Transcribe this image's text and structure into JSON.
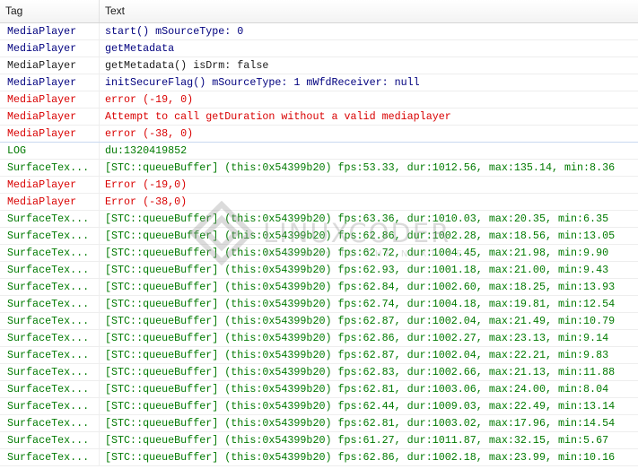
{
  "columns": {
    "tag": "Tag",
    "text": "Text"
  },
  "colors": {
    "debug": "#00007f",
    "error": "#d90000",
    "info": "#007a00",
    "verbose": "#1a1a1a"
  },
  "rows": [
    {
      "tag": "MediaPlayer",
      "text": "start() mSourceType: 0",
      "level": "D"
    },
    {
      "tag": "MediaPlayer",
      "text": "getMetadata",
      "level": "D"
    },
    {
      "tag": "MediaPlayer",
      "text": "getMetadata() isDrm: false",
      "level": "V"
    },
    {
      "tag": "MediaPlayer",
      "text": "initSecureFlag() mSourceType: 1 mWfdReceiver: null",
      "level": "D"
    },
    {
      "tag": "MediaPlayer",
      "text": "error (-19, 0)",
      "level": "E"
    },
    {
      "tag": "MediaPlayer",
      "text": "Attempt to call getDuration without a valid mediaplayer",
      "level": "E"
    },
    {
      "tag": "MediaPlayer",
      "text": "error (-38, 0)",
      "level": "E",
      "selected": true
    },
    {
      "tag": "LOG",
      "text": "du:1320419852",
      "level": "I"
    },
    {
      "tag": "SurfaceTex...",
      "text": "[STC::queueBuffer] (this:0x54399b20) fps:53.33, dur:1012.56, max:135.14, min:8.36",
      "level": "I"
    },
    {
      "tag": "MediaPlayer",
      "text": "Error (-19,0)",
      "level": "E"
    },
    {
      "tag": "MediaPlayer",
      "text": "Error (-38,0)",
      "level": "E"
    },
    {
      "tag": "SurfaceTex...",
      "text": "[STC::queueBuffer] (this:0x54399b20) fps:63.36, dur:1010.03, max:20.35, min:6.35",
      "level": "I"
    },
    {
      "tag": "SurfaceTex...",
      "text": "[STC::queueBuffer] (this:0x54399b20) fps:62.86, dur:1002.28, max:18.56, min:13.05",
      "level": "I"
    },
    {
      "tag": "SurfaceTex...",
      "text": "[STC::queueBuffer] (this:0x54399b20) fps:62.72, dur:1004.45, max:21.98, min:9.90",
      "level": "I"
    },
    {
      "tag": "SurfaceTex...",
      "text": "[STC::queueBuffer] (this:0x54399b20) fps:62.93, dur:1001.18, max:21.00, min:9.43",
      "level": "I"
    },
    {
      "tag": "SurfaceTex...",
      "text": "[STC::queueBuffer] (this:0x54399b20) fps:62.84, dur:1002.60, max:18.25, min:13.93",
      "level": "I"
    },
    {
      "tag": "SurfaceTex...",
      "text": "[STC::queueBuffer] (this:0x54399b20) fps:62.74, dur:1004.18, max:19.81, min:12.54",
      "level": "I"
    },
    {
      "tag": "SurfaceTex...",
      "text": "[STC::queueBuffer] (this:0x54399b20) fps:62.87, dur:1002.04, max:21.49, min:10.79",
      "level": "I"
    },
    {
      "tag": "SurfaceTex...",
      "text": "[STC::queueBuffer] (this:0x54399b20) fps:62.86, dur:1002.27, max:23.13, min:9.14",
      "level": "I"
    },
    {
      "tag": "SurfaceTex...",
      "text": "[STC::queueBuffer] (this:0x54399b20) fps:62.87, dur:1002.04, max:22.21, min:9.83",
      "level": "I"
    },
    {
      "tag": "SurfaceTex...",
      "text": "[STC::queueBuffer] (this:0x54399b20) fps:62.83, dur:1002.66, max:21.13, min:11.88",
      "level": "I"
    },
    {
      "tag": "SurfaceTex...",
      "text": "[STC::queueBuffer] (this:0x54399b20) fps:62.81, dur:1003.06, max:24.00, min:8.04",
      "level": "I"
    },
    {
      "tag": "SurfaceTex...",
      "text": "[STC::queueBuffer] (this:0x54399b20) fps:62.44, dur:1009.03, max:22.49, min:13.14",
      "level": "I"
    },
    {
      "tag": "SurfaceTex...",
      "text": "[STC::queueBuffer] (this:0x54399b20) fps:62.81, dur:1003.02, max:17.96, min:14.54",
      "level": "I"
    },
    {
      "tag": "SurfaceTex...",
      "text": "[STC::queueBuffer] (this:0x54399b20) fps:61.27, dur:1011.87, max:32.15, min:5.67",
      "level": "I"
    },
    {
      "tag": "SurfaceTex...",
      "text": "[STC::queueBuffer] (this:0x54399b20) fps:62.86, dur:1002.18, max:23.99, min:10.16",
      "level": "I"
    }
  ],
  "watermark": {
    "brand": "LINUXCODER",
    "tagline": "NEW WAY TO THE NEXT GEN"
  }
}
